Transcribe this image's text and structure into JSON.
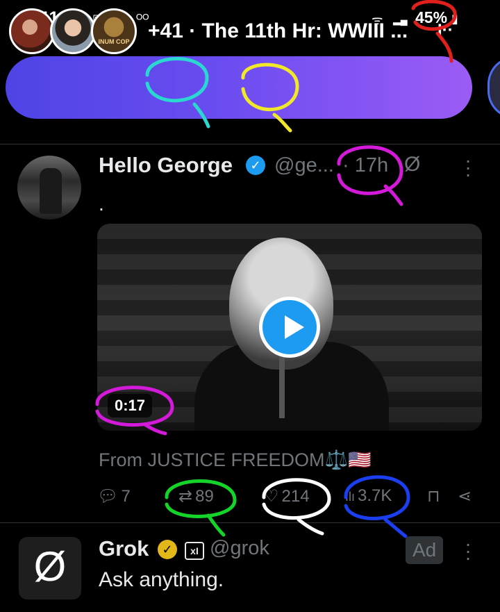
{
  "status_bar": {
    "time": "11:39",
    "battery": "45%"
  },
  "space_banner": {
    "text": "+41 · The 11th Hr: WWIII ...",
    "avatar3_label": "INUM COP"
  },
  "tweet": {
    "name": "Hello George",
    "handle": "@ge...",
    "time": "· 17h",
    "text": ".",
    "video_duration": "0:17",
    "from": "From JUSTICE FREEDOM⚖️🇺🇸",
    "replies": "7",
    "reposts": "89",
    "likes": "214",
    "views": "3.7K"
  },
  "ad": {
    "name": "Grok",
    "handle": "@grok",
    "ad_label": "Ad",
    "text": "Ask anything."
  },
  "icons": [
    "gallery-icon",
    "messenger-icon",
    "voicemail-icon",
    "wifi-icon",
    "signal-icon",
    "battery-icon",
    "verified-icon",
    "grok-icon",
    "more-icon",
    "play-icon",
    "reply-icon",
    "repost-icon",
    "like-icon",
    "views-icon",
    "bookmark-icon",
    "share-icon"
  ],
  "colors": {
    "accent": "#1d9bf0",
    "banner_start": "#4e44e6",
    "banner_end": "#9b5cf5",
    "muted": "#71767b"
  }
}
